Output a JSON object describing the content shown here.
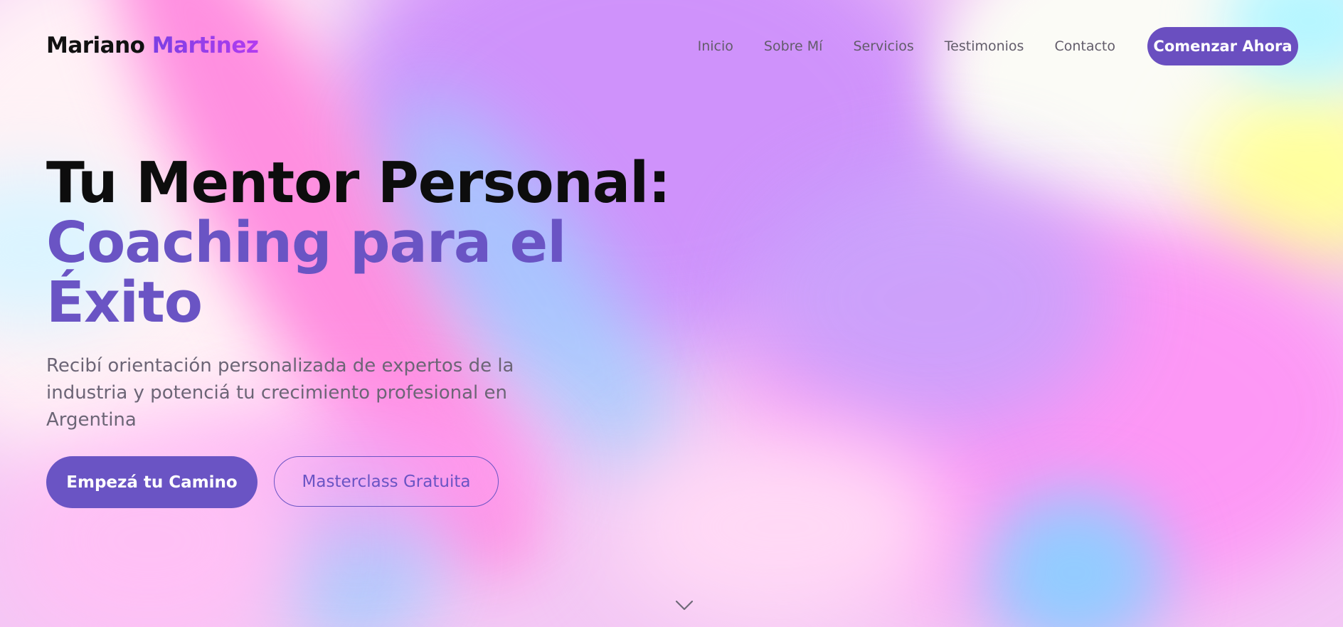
{
  "brand": {
    "first_name": "Mariano",
    "last_name": "Martinez"
  },
  "nav": {
    "links": [
      "Inicio",
      "Sobre Mí",
      "Servicios",
      "Testimonios",
      "Contacto"
    ],
    "cta_label": "Comenzar Ahora"
  },
  "hero": {
    "title": "Tu Mentor Personal:",
    "accent": "Coaching para el Éxito",
    "subtitle": "Recibí orientación personalizada de expertos de la industria y potenciá tu crecimiento profesional en Argentina",
    "primary_button": "Empezá tu Camino",
    "secondary_button": "Masterclass Gratuita"
  },
  "icons": {
    "scroll": "chevron-down-icon"
  },
  "colors": {
    "accent": "#6a54c4",
    "logo_gradient_start": "#7b3fe4",
    "logo_gradient_end": "#b23cf0",
    "nav_text": "#625c6a",
    "subtitle_text": "#6c6576",
    "title_text": "#0d0d0d"
  }
}
